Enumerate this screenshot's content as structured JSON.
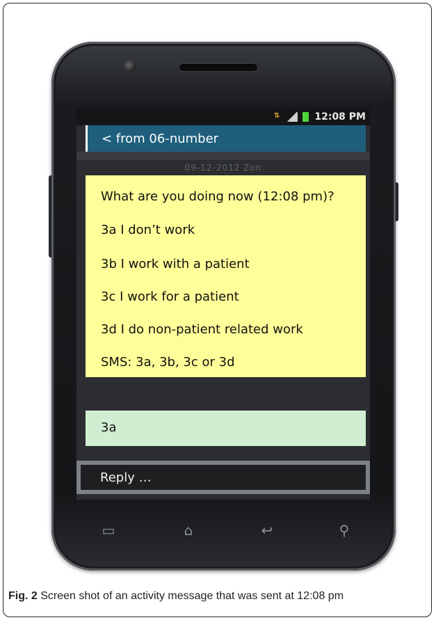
{
  "status_bar": {
    "time": "12:08 PM",
    "icons": [
      "data-icon",
      "signal-icon",
      "battery-icon"
    ]
  },
  "conversation": {
    "back_label": "< from 06-number",
    "date_line": "09-12-2012 Zon"
  },
  "incoming_message": {
    "lines": [
      "What are you doing now (12:08 pm)?",
      "3a I don’t work",
      "3b I work with a patient",
      "3c I work for a patient",
      "3d I do non-patient related work",
      "SMS: 3a, 3b, 3c or 3d"
    ]
  },
  "outgoing_message": {
    "text": "3a"
  },
  "composer": {
    "placeholder": "Reply …"
  },
  "nav_keys": [
    "menu-icon",
    "home-icon",
    "back-icon",
    "search-icon"
  ],
  "caption": {
    "label": "Fig. 2",
    "text": " Screen shot of an activity message that was sent at 12:08 pm"
  },
  "colors": {
    "header_bar": "#1f5f7d",
    "incoming_bg": "#ffff99",
    "outgoing_bg": "#d2eed2",
    "battery": "#4dd53a"
  }
}
